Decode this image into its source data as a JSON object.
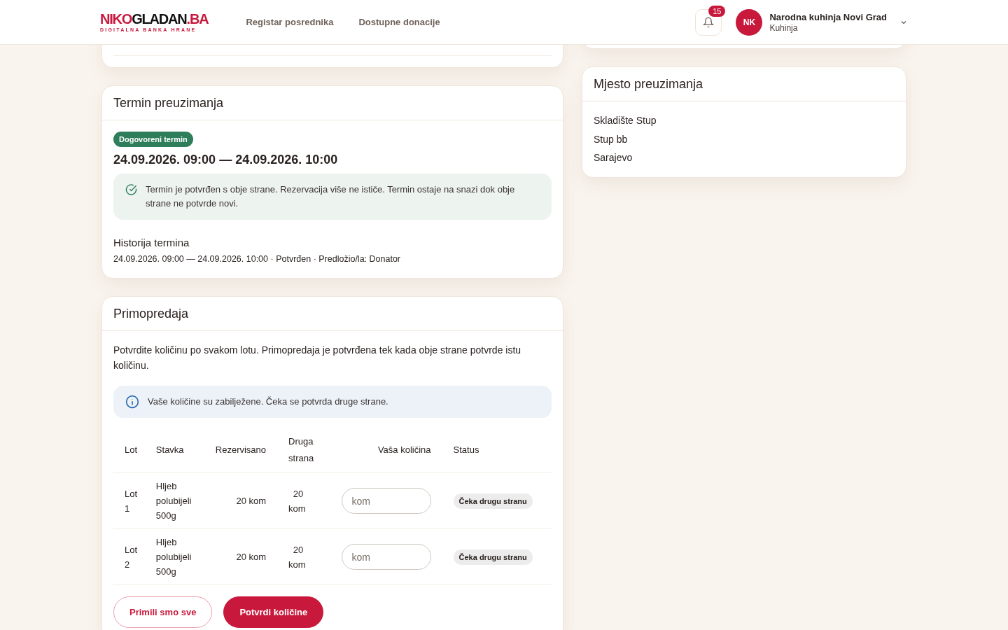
{
  "header": {
    "logo": {
      "brand_dark_part": "NIKO",
      "brand_main": "GLADAN",
      "brand_suffix": ".BA",
      "tagline": "DIGITALNA BANKA HRANE"
    },
    "nav": [
      {
        "label": "Registar posrednika"
      },
      {
        "label": "Dostupne donacije"
      }
    ],
    "notifications": {
      "count": "15"
    },
    "user": {
      "initials": "NK",
      "name": "Narodna kuhinja Novi Grad",
      "role": "Kuhinja"
    }
  },
  "pickup_term": {
    "title": "Termin preuzimanja",
    "badge": "Dogovoreni termin",
    "range": "24.09.2026. 09:00 — 24.09.2026. 10:00",
    "notice": "Termin je potvrđen s obje strane. Rezervacija više ne ističe. Termin ostaje na snazi dok obje strane ne potvrde novi.",
    "history_title": "Historija termina",
    "history": [
      "24.09.2026. 09:00 — 24.09.2026. 10:00 · Potvrđen · Predložio/la: Donator"
    ]
  },
  "handover": {
    "title": "Primopredaja",
    "intro": "Potvrdite količinu po svakom lotu. Primopredaja je potvrđena tek kada obje strane potvrde istu količinu.",
    "info": "Vaše količine su zabilježene. Čeka se potvrda druge strane.",
    "columns": [
      "Lot",
      "Stavka",
      "Rezervisano",
      "Druga strana",
      "Vaša količina",
      "Status"
    ],
    "rows": [
      {
        "lot": "Lot 1",
        "item": "Hljeb polubijeli 500g",
        "reserved": "20 kom",
        "other_side": "20 kom",
        "your_quantity_placeholder": "kom",
        "status": "Čeka drugu stranu"
      },
      {
        "lot": "Lot 2",
        "item": "Hljeb polubijeli 500g",
        "reserved": "20 kom",
        "other_side": "20 kom",
        "your_quantity_placeholder": "kom",
        "status": "Čeka drugu stranu"
      }
    ],
    "buttons": [
      {
        "label": "Primili smo sve",
        "kind": "secondary"
      },
      {
        "label": "Potvrdi količine",
        "kind": "primary"
      }
    ]
  },
  "pickup_place": {
    "title": "Mjesto preuzimanja",
    "lines": [
      "Skladište Stup",
      "Stup bb",
      "Sarajevo"
    ]
  }
}
